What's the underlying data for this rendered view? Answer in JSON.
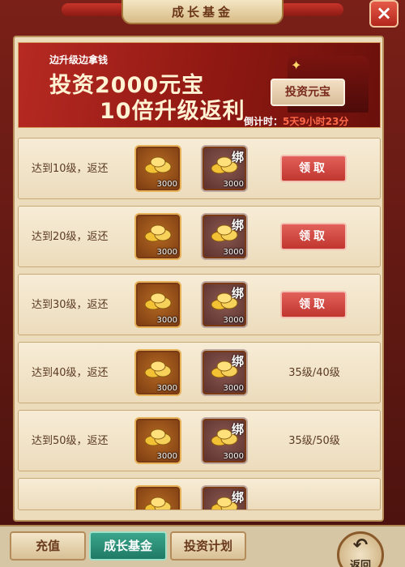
{
  "window": {
    "title": "成长基金",
    "close_label": "×"
  },
  "banner": {
    "subtitle": "边升级边拿钱",
    "line1": "投资2000元宝",
    "line2": "10倍升级返利",
    "invest_button": "投资元宝",
    "countdown_label": "倒计时：",
    "countdown_value": "5天9小时23分"
  },
  "rewards": {
    "gold_amount": "3000",
    "bound_amount": "3000",
    "bound_mark": "绑",
    "claim_label": "领取",
    "rows": [
      {
        "label": "达到10级，返还",
        "status": "claim"
      },
      {
        "label": "达到20级，返还",
        "status": "claim"
      },
      {
        "label": "达到30级，返还",
        "status": "claim"
      },
      {
        "label": "达到40级，返还",
        "status": "progress",
        "progress": "35级/40级"
      },
      {
        "label": "达到50级，返还",
        "status": "progress",
        "progress": "35级/50级"
      }
    ]
  },
  "bottom": {
    "tabs": [
      {
        "label": "充值",
        "active": false
      },
      {
        "label": "成长基金",
        "active": true
      },
      {
        "label": "投资计划",
        "active": false
      }
    ],
    "back_label": "返回",
    "back_icon": "↶"
  },
  "colors": {
    "accent_red": "#c0362e",
    "active_tab": "#2a8f76",
    "panel": "#ecdcbc"
  },
  "icons": {
    "gold": "gold-ingot-icon",
    "bound_gold": "bound-gold-ingot-icon",
    "back": "back-arrow-icon"
  }
}
